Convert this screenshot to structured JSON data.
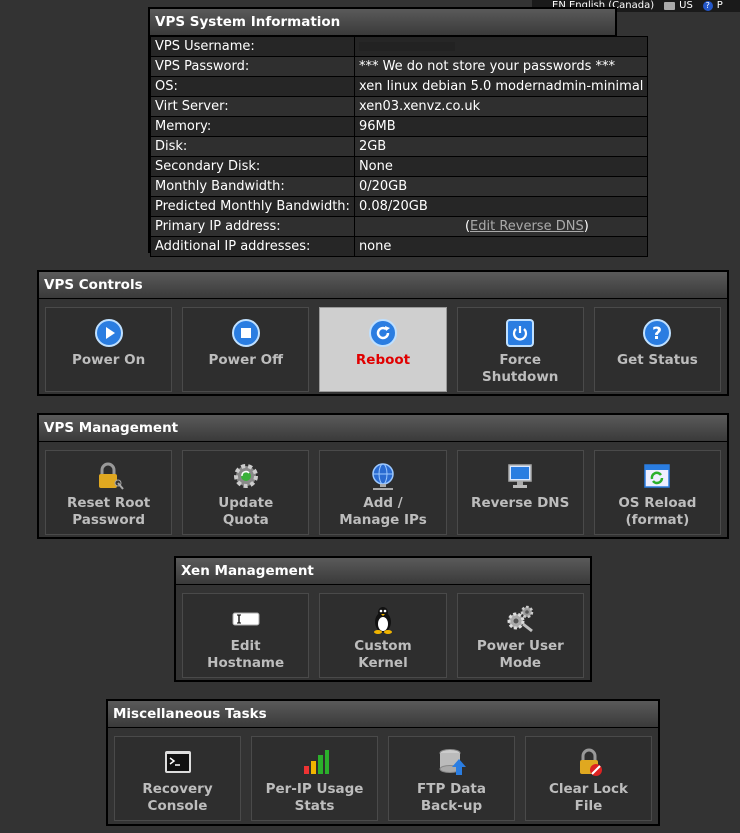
{
  "langbar": {
    "language": "EN English (Canada)",
    "layout": "US",
    "help_glyph": "?",
    "more": "P"
  },
  "info": {
    "title": "VPS System Information",
    "rows": [
      {
        "label": "VPS Username:",
        "value": ""
      },
      {
        "label": "VPS Password:",
        "value": "*** We do not store your passwords ***"
      },
      {
        "label": "OS:",
        "value": "xen linux debian 5.0 modernadmin-minimal"
      },
      {
        "label": "Virt Server:",
        "value": "xen03.xenvz.co.uk"
      },
      {
        "label": "Memory:",
        "value": "96MB"
      },
      {
        "label": "Disk:",
        "value": "2GB"
      },
      {
        "label": "Secondary Disk:",
        "value": "None"
      },
      {
        "label": "Monthly Bandwidth:",
        "value": "0/20GB"
      },
      {
        "label": "Predicted Monthly Bandwidth:",
        "value": "0.08/20GB"
      },
      {
        "label": "Primary IP address:",
        "value_prefix": "(",
        "link": "Edit Reverse DNS",
        "value_suffix": ")"
      },
      {
        "label": "Additional IP addresses:",
        "value": "none"
      }
    ]
  },
  "controls": {
    "title": "VPS Controls",
    "buttons": [
      {
        "label": "Power On",
        "icon": "play-icon"
      },
      {
        "label": "Power Off",
        "icon": "stop-icon"
      },
      {
        "label": "Reboot",
        "icon": "reboot-icon",
        "active": true
      },
      {
        "label": "Force\nShutdown",
        "icon": "power-icon"
      },
      {
        "label": "Get Status",
        "icon": "question-icon"
      }
    ]
  },
  "management": {
    "title": "VPS Management",
    "buttons": [
      {
        "label": "Reset Root\nPassword",
        "icon": "lock-key-icon"
      },
      {
        "label": "Update\nQuota",
        "icon": "gear-refresh-icon"
      },
      {
        "label": "Add /\nManage IPs",
        "icon": "globe-network-icon"
      },
      {
        "label": "Reverse DNS",
        "icon": "monitor-icon"
      },
      {
        "label": "OS Reload\n(format)",
        "icon": "window-refresh-icon"
      }
    ]
  },
  "xen": {
    "title": "Xen Management",
    "buttons": [
      {
        "label": "Edit\nHostname",
        "icon": "text-field-icon"
      },
      {
        "label": "Custom\nKernel",
        "icon": "tux-penguin-icon"
      },
      {
        "label": "Power User\nMode",
        "icon": "gears-icon"
      }
    ]
  },
  "misc": {
    "title": "Miscellaneous Tasks",
    "buttons": [
      {
        "label": "Recovery\nConsole",
        "icon": "terminal-icon"
      },
      {
        "label": "Per-IP Usage\nStats",
        "icon": "bar-chart-icon"
      },
      {
        "label": "FTP Data\nBack-up",
        "icon": "database-upload-icon"
      },
      {
        "label": "Clear Lock\nFile",
        "icon": "lock-clear-icon"
      }
    ]
  },
  "colors": {
    "background": "#333333",
    "active_button": "#cfcfcf",
    "active_label": "#e00000",
    "label": "#bdbdbd"
  }
}
